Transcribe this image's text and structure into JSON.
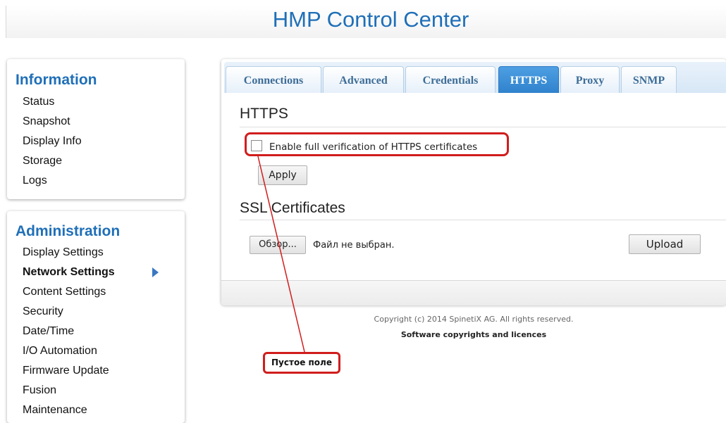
{
  "header": {
    "title": "HMP Control Center"
  },
  "sidebar": {
    "information": {
      "heading": "Information",
      "items": [
        {
          "label": "Status"
        },
        {
          "label": "Snapshot"
        },
        {
          "label": "Display Info"
        },
        {
          "label": "Storage"
        },
        {
          "label": "Logs"
        }
      ]
    },
    "administration": {
      "heading": "Administration",
      "active_item": "Network Settings",
      "items": [
        {
          "label": "Display Settings"
        },
        {
          "label": "Network Settings"
        },
        {
          "label": "Content Settings"
        },
        {
          "label": "Security"
        },
        {
          "label": "Date/Time"
        },
        {
          "label": "I/O Automation"
        },
        {
          "label": "Firmware Update"
        },
        {
          "label": "Fusion"
        },
        {
          "label": "Maintenance"
        }
      ]
    }
  },
  "tabs": {
    "active": "HTTPS",
    "items": [
      {
        "label": "Connections"
      },
      {
        "label": "Advanced"
      },
      {
        "label": "Credentials"
      },
      {
        "label": "HTTPS"
      },
      {
        "label": "Proxy"
      },
      {
        "label": "SNMP"
      }
    ]
  },
  "https": {
    "title": "HTTPS",
    "checkbox_label": "Enable full verification of HTTPS certificates",
    "checkbox_checked": false,
    "apply_label": "Apply"
  },
  "ssl": {
    "title": "SSL Certificates",
    "browse_label": "Обзор...",
    "no_file_text": "Файл не выбран.",
    "upload_label": "Upload"
  },
  "footer": {
    "copyright": "Copyright (c) 2014 SpinetiX AG. All rights reserved.",
    "licences_link": "Software copyrights and licences"
  },
  "annotation": {
    "callout_text": "Пустое поле",
    "color": "#d11d1d"
  }
}
